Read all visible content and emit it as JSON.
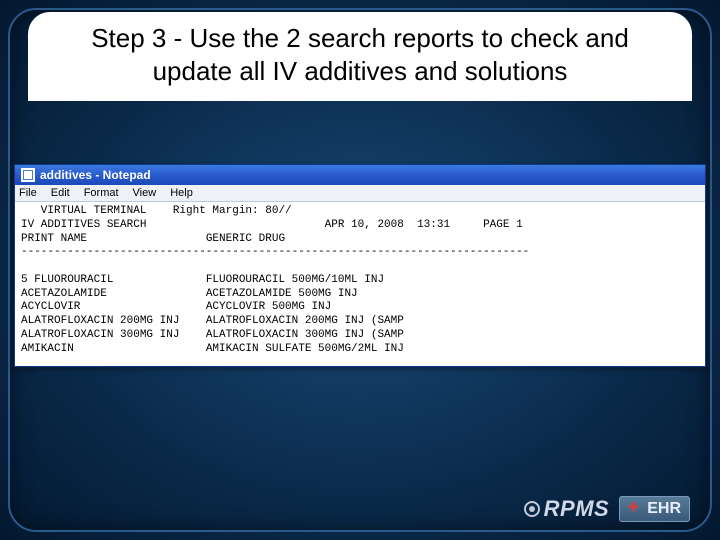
{
  "slide": {
    "title": "Step 3 - Use the 2 search reports to check and update all IV additives and solutions"
  },
  "notepad": {
    "title": "additives - Notepad",
    "menu": {
      "file": "File",
      "edit": "Edit",
      "format": "Format",
      "view": "View",
      "help": "Help"
    },
    "body": "   VIRTUAL TERMINAL    Right Margin: 80//\nIV ADDITIVES SEARCH                           APR 10, 2008  13:31     PAGE 1\nPRINT NAME                  GENERIC DRUG\n-----------------------------------------------------------------------------\n\n5 FLUOROURACIL              FLUOROURACIL 500MG/10ML INJ\nACETAZOLAMIDE               ACETAZOLAMIDE 500MG INJ\nACYCLOVIR                   ACYCLOVIR 500MG INJ\nALATROFLOXACIN 200MG INJ    ALATROFLOXACIN 200MG INJ (SAMP\nALATROFLOXACIN 300MG INJ    ALATROFLOXACIN 300MG INJ (SAMP\nAMIKACIN                    AMIKACIN SULFATE 500MG/2ML INJ"
  },
  "branding": {
    "rpms": "RPMS",
    "ehr": "EHR"
  }
}
